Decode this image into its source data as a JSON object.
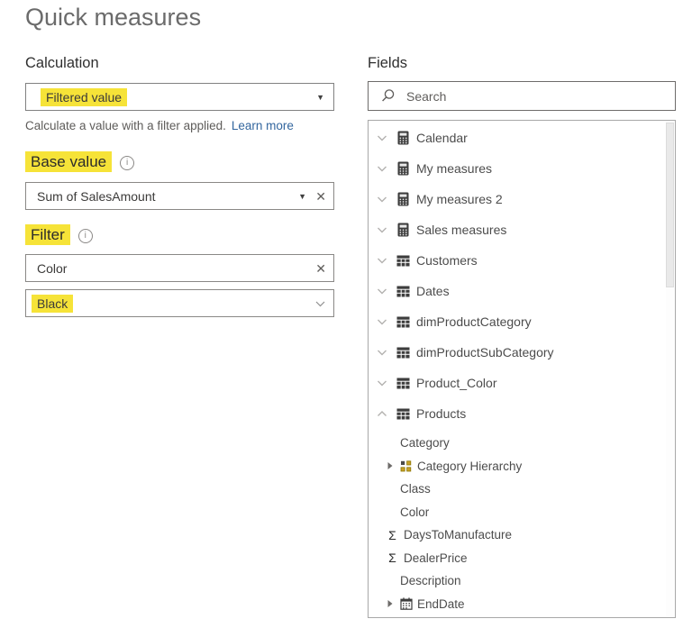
{
  "title": "Quick measures",
  "calculation": {
    "label": "Calculation",
    "selected_value": "Filtered value",
    "description": "Calculate a value with a filter applied.",
    "learn_more_label": "Learn more"
  },
  "base_value": {
    "label": "Base value",
    "value": "Sum of SalesAmount"
  },
  "filter": {
    "label": "Filter",
    "field": "Color",
    "value": "Black"
  },
  "fields_panel": {
    "label": "Fields",
    "search_placeholder": "Search",
    "tree": [
      {
        "label": "Calendar",
        "level": 0,
        "icon": "calculator-icon",
        "expander": "down"
      },
      {
        "label": "My measures",
        "level": 0,
        "icon": "calculator-icon",
        "expander": "down"
      },
      {
        "label": "My measures 2",
        "level": 0,
        "icon": "calculator-icon",
        "expander": "down"
      },
      {
        "label": "Sales measures",
        "level": 0,
        "icon": "calculator-icon",
        "expander": "down"
      },
      {
        "label": "Customers",
        "level": 0,
        "icon": "table-icon",
        "expander": "down"
      },
      {
        "label": "Dates",
        "level": 0,
        "icon": "table-icon",
        "expander": "down"
      },
      {
        "label": "dimProductCategory",
        "level": 0,
        "icon": "table-icon",
        "expander": "down"
      },
      {
        "label": "dimProductSubCategory",
        "level": 0,
        "icon": "table-icon",
        "expander": "down"
      },
      {
        "label": "Product_Color",
        "level": 0,
        "icon": "table-icon",
        "expander": "down"
      },
      {
        "label": "Products",
        "level": 0,
        "icon": "table-icon",
        "expander": "up"
      },
      {
        "label": "Category",
        "level": 1,
        "icon": null,
        "expander": null
      },
      {
        "label": "Category Hierarchy",
        "level": 1,
        "icon": "hierarchy-icon",
        "expander": "right"
      },
      {
        "label": "Class",
        "level": 1,
        "icon": null,
        "expander": null
      },
      {
        "label": "Color",
        "level": 1,
        "icon": null,
        "expander": null
      },
      {
        "label": "DaysToManufacture",
        "level": 1,
        "icon": "sigma-icon",
        "expander": null
      },
      {
        "label": "DealerPrice",
        "level": 1,
        "icon": "sigma-icon",
        "expander": null
      },
      {
        "label": "Description",
        "level": 1,
        "icon": null,
        "expander": null
      },
      {
        "label": "EndDate",
        "level": 1,
        "icon": "calendar-icon",
        "expander": "right"
      }
    ]
  },
  "colors": {
    "highlight": "#f6e338",
    "link": "#33669e",
    "hierarchy_gold": "#c9a227"
  }
}
